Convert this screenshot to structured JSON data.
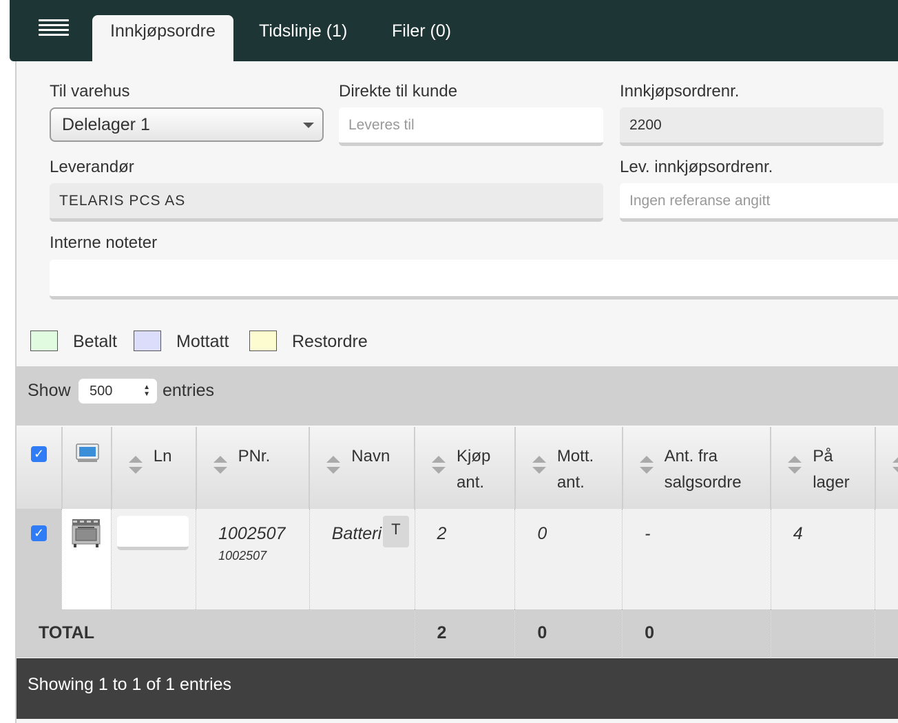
{
  "tabs": [
    {
      "label": "Innkjøpsordre"
    },
    {
      "label": "Tidslinje (1)"
    },
    {
      "label": "Filer (0)"
    }
  ],
  "form": {
    "til_varehus": {
      "label": "Til varehus",
      "value": "Delelager 1"
    },
    "direkte_til_kunde": {
      "label": "Direkte til kunde",
      "placeholder": "Leveres til"
    },
    "innkjopsordrenr": {
      "label": "Innkjøpsordrenr.",
      "value": "2200"
    },
    "leverandor": {
      "label": "Leverandør",
      "value": "TELARIS PCS AS"
    },
    "lev_innkjopsordrenr": {
      "label": "Lev. innkjøpsordrenr.",
      "placeholder": "Ingen referanse angitt"
    },
    "interne_noteter": {
      "label": "Interne noteter",
      "value": ""
    }
  },
  "legend": [
    {
      "label": "Betalt",
      "color": "#e0fbe0"
    },
    {
      "label": "Mottatt",
      "color": "#dcdcfb"
    },
    {
      "label": "Restordre",
      "color": "#fdfcd0"
    }
  ],
  "table_controls": {
    "show": "Show",
    "page_size": "500",
    "entries": "entries"
  },
  "columns": [
    {
      "line1": "",
      "line2": ""
    },
    {
      "line1": "",
      "line2": ""
    },
    {
      "line1": "Ln",
      "line2": ""
    },
    {
      "line1": "PNr.",
      "line2": ""
    },
    {
      "line1": "Navn",
      "line2": ""
    },
    {
      "line1": "Kjøp",
      "line2": "ant."
    },
    {
      "line1": "Mott.",
      "line2": "ant."
    },
    {
      "line1": "Ant. fra",
      "line2": "salgsordre"
    },
    {
      "line1": "På",
      "line2": "lager"
    }
  ],
  "rows": [
    {
      "ln": "",
      "pnr": "1002507",
      "pnr_sub": "1002507",
      "navn": "Batteri",
      "navn_badge": "T",
      "kjop_ant": "2",
      "mott_ant": "0",
      "ant_fra_salgsordre": "-",
      "pa_lager": "4"
    }
  ],
  "totals": {
    "label": "TOTAL",
    "kjop_ant": "2",
    "mott_ant": "0",
    "ant_fra_salgsordre": "0"
  },
  "footer": {
    "info": "Showing 1 to 1 of 1 entries"
  },
  "colors": {
    "topbar": "#1e3535",
    "checkbox": "#2f7cf6",
    "footer": "#404040"
  }
}
